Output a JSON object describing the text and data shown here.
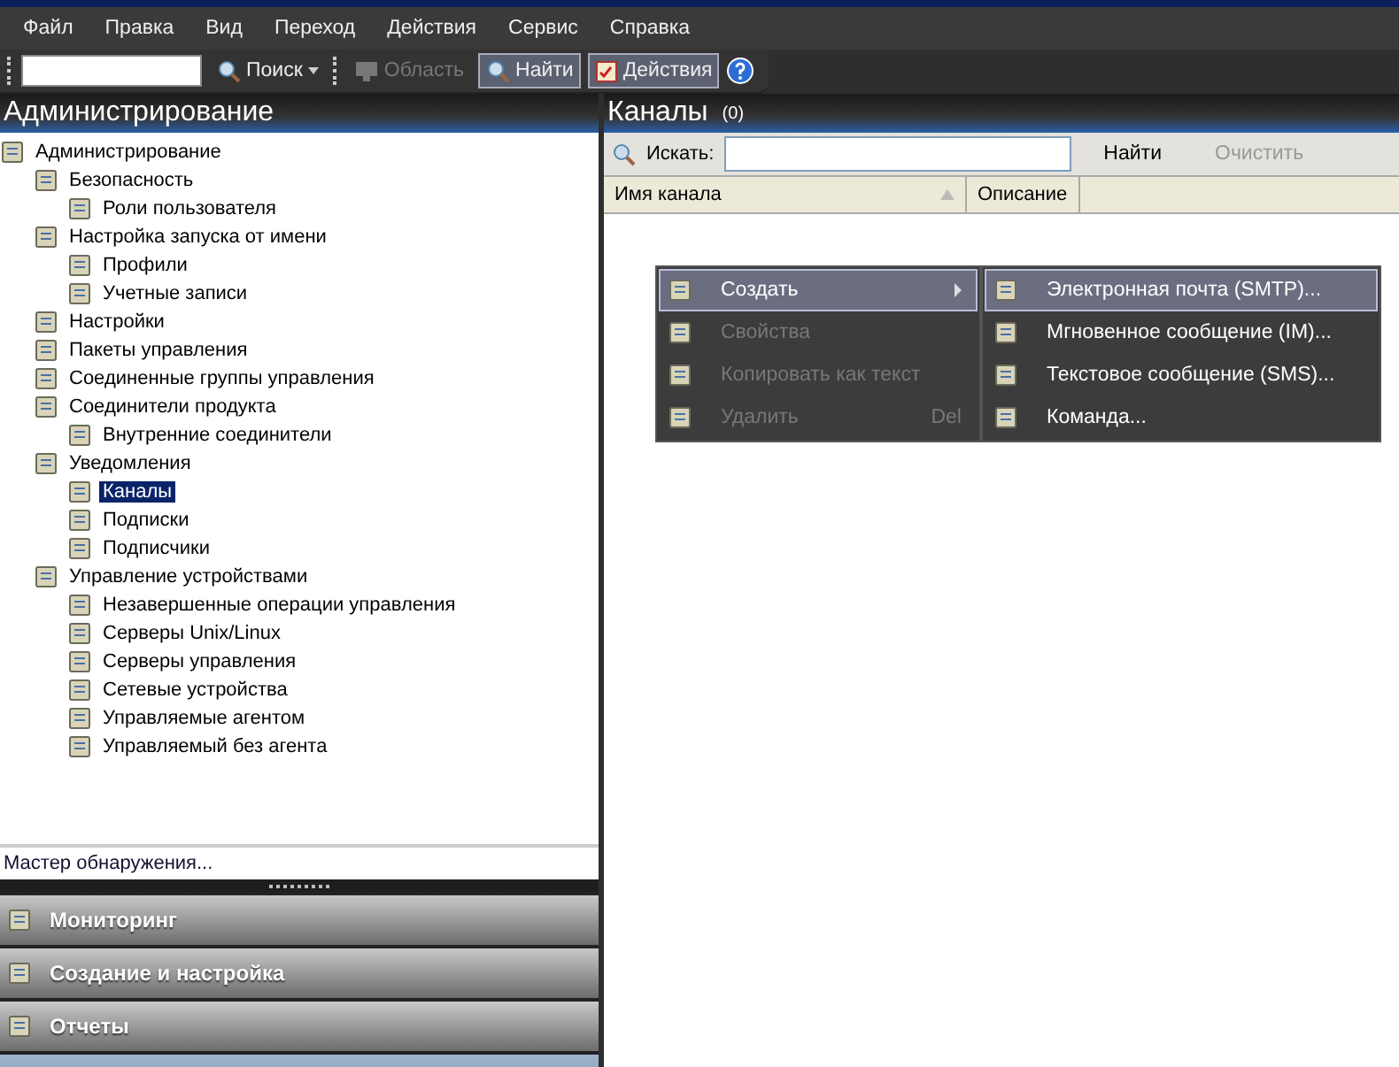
{
  "menu_bar": [
    "Файл",
    "Правка",
    "Вид",
    "Переход",
    "Действия",
    "Сервис",
    "Справка"
  ],
  "toolbar": {
    "search_button": "Поиск",
    "scope_button": {
      "label": "Область",
      "disabled": true
    },
    "find_button": {
      "label": "Найти",
      "pressed": true
    },
    "actions_button": {
      "label": "Действия",
      "pressed": true
    }
  },
  "left_panel": {
    "title": "Администрирование",
    "tree": [
      {
        "label": "Администрирование",
        "selected": false,
        "children": [
          {
            "label": "Безопасность",
            "selected": false,
            "children": [
              {
                "label": "Роли пользователя",
                "selected": false
              }
            ]
          },
          {
            "label": "Настройка запуска от имени",
            "selected": false,
            "children": [
              {
                "label": "Профили",
                "selected": false
              },
              {
                "label": "Учетные записи",
                "selected": false
              }
            ]
          },
          {
            "label": "Настройки",
            "selected": false
          },
          {
            "label": "Пакеты управления",
            "selected": false
          },
          {
            "label": "Соединенные группы управления",
            "selected": false
          },
          {
            "label": "Соединители продукта",
            "selected": false,
            "children": [
              {
                "label": "Внутренние соединители",
                "selected": false
              }
            ]
          },
          {
            "label": "Уведомления",
            "selected": false,
            "children": [
              {
                "label": "Каналы",
                "selected": true
              },
              {
                "label": "Подписки",
                "selected": false
              },
              {
                "label": "Подписчики",
                "selected": false
              }
            ]
          },
          {
            "label": "Управление устройствами",
            "selected": false,
            "children": [
              {
                "label": "Незавершенные операции управления",
                "selected": false
              },
              {
                "label": "Серверы Unix/Linux",
                "selected": false
              },
              {
                "label": "Серверы управления",
                "selected": false
              },
              {
                "label": "Сетевые устройства",
                "selected": false
              },
              {
                "label": "Управляемые агентом",
                "selected": false
              },
              {
                "label": "Управляемый без агента",
                "selected": false
              }
            ]
          }
        ]
      }
    ],
    "link": "Мастер обнаружения...",
    "nav_buttons": [
      {
        "label": "Мониторинг"
      },
      {
        "label": "Создание и настройка"
      },
      {
        "label": "Отчеты"
      }
    ]
  },
  "right_panel": {
    "title": "Каналы",
    "count": "(0)",
    "search_label": "Искать:",
    "find_button": {
      "label": "Найти",
      "disabled": false
    },
    "clear_button": {
      "label": "Очистить",
      "disabled": true
    },
    "columns": [
      {
        "label": "Имя канала",
        "sorted": true
      },
      {
        "label": "Описание",
        "sorted": false
      }
    ],
    "context_menu": [
      {
        "label": "Создать",
        "submenu": true,
        "selected": true,
        "disabled": false
      },
      {
        "label": "Свойства",
        "submenu": false,
        "selected": false,
        "disabled": true
      },
      {
        "label": "Копировать как текст",
        "submenu": false,
        "selected": false,
        "disabled": true
      },
      {
        "label": "Удалить",
        "shortcut": "Del",
        "submenu": false,
        "selected": false,
        "disabled": true
      }
    ],
    "submenu": [
      {
        "label": "Электронная почта (SMTP)...",
        "selected": true
      },
      {
        "label": "Мгновенное сообщение (IM)...",
        "selected": false
      },
      {
        "label": "Текстовое сообщение (SMS)...",
        "selected": false
      },
      {
        "label": "Команда...",
        "selected": false
      }
    ]
  }
}
